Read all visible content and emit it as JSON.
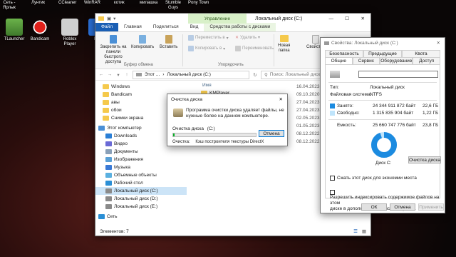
{
  "desktop": {
    "top_labels": [
      "Сеть -\nЯрлык",
      "Лунтик",
      "CCleaner",
      "WinRAR",
      "котик",
      "милашка",
      "Stumble\nGuys",
      "Pony Town"
    ],
    "icons": [
      {
        "label": "TLauncher",
        "name": "tlauncher"
      },
      {
        "label": "Bandicam",
        "name": "bandicam"
      },
      {
        "label": "Roblox\nPlayer",
        "name": "roblox-player"
      },
      {
        "label": "Ro\nSt",
        "name": "roblox-studio"
      }
    ]
  },
  "explorer": {
    "context_tab": "Управление",
    "title": "Локальный диск (C:)",
    "tabs": [
      "Файл",
      "Главная",
      "Поделиться",
      "Вид",
      "Средства работы с дисками"
    ],
    "ribbon": {
      "pin": "Закрепить на панели\nбыстрого доступа",
      "copy": "Копировать",
      "paste": "Вставить",
      "move_to": "Переместить в",
      "copy_to": "Копировать в",
      "delete": "Удалить",
      "rename": "Переименовать",
      "new_folder": "Новая\nпапка",
      "properties": "Свойства",
      "group_clipboard": "Буфер обмена",
      "group_organize": "Упорядочить"
    },
    "address": {
      "path_prefix": "Этот ...",
      "path_current": "Локальный диск (C:)",
      "search_placeholder": "Поиск: Локальный диск (C:)"
    },
    "nav_items": [
      {
        "label": "Windows",
        "icon": "folder"
      },
      {
        "label": "Bandicam",
        "icon": "folder"
      },
      {
        "label": "авы",
        "icon": "folder"
      },
      {
        "label": "обои",
        "icon": "folder"
      },
      {
        "label": "Снимки экрана",
        "icon": "folder"
      },
      {
        "label": "Этот компьютер",
        "icon": "pc"
      },
      {
        "label": "Downloads",
        "icon": "download"
      },
      {
        "label": "Видео",
        "icon": "video"
      },
      {
        "label": "Документы",
        "icon": "docs"
      },
      {
        "label": "Изображения",
        "icon": "images"
      },
      {
        "label": "Музыка",
        "icon": "music"
      },
      {
        "label": "Объемные объекты",
        "icon": "3d"
      },
      {
        "label": "Рабочий стол",
        "icon": "desktop"
      },
      {
        "label": "Локальный диск (C:)",
        "icon": "drive",
        "selected": true
      },
      {
        "label": "Локальный диск (D:)",
        "icon": "drive"
      },
      {
        "label": "Локальный диск (E:)",
        "icon": "drive"
      },
      {
        "label": "Сеть",
        "icon": "network"
      }
    ],
    "column_name": "Имя",
    "first_file": "KMPlayer",
    "dates": [
      "16.04.2023 13:",
      "09.10.2020 22:",
      "27.04.2023 13:",
      "27.04.2023 13:",
      "02.05.2023 15:",
      "01.05.2023 22:",
      "08.12.2022 22:",
      "08.12.2022 22:"
    ],
    "status": "Элементов: 7"
  },
  "cleanup": {
    "title": "Очистка диска",
    "message": "Программа очистки диска удаляет файлы, не\nнужные более на данном компьютере.",
    "drive_label": "Очистка диска",
    "drive_value": "(C:)",
    "cancel": "Отмена",
    "status_label": "Очистка:",
    "status_value": "Кэш построителя текстуры DirectX",
    "progress": 0.02
  },
  "props": {
    "title": "Свойства: Локальный диск (C:)",
    "tabs_row1": [
      "Безопасность",
      "Предыдущие версии",
      "Квота"
    ],
    "tabs_row2": [
      "Общие",
      "Сервис",
      "Оборудование",
      "Доступ"
    ],
    "type_label": "Тип:",
    "type_value": "Локальный диск",
    "fs_label": "Файловая система:",
    "fs_value": "NTFS",
    "used_label": "Занято:",
    "used_bytes": "24 344 911 872 байт",
    "used_gb": "22,6 ГБ",
    "free_label": "Свободно:",
    "free_bytes": "1 315 835 904 байт",
    "free_gb": "1,22 ГБ",
    "cap_label": "Емкость:",
    "cap_bytes": "25 660 747 776 байт",
    "cap_gb": "23,8 ГБ",
    "drive_name": "Диск C:",
    "cleanup_btn": "Очистка диска",
    "compress": "Сжать этот диск для экономии места",
    "index": "Разрешить индексировать содержимое файлов на этом\nдиске в дополнение к свойствам файла",
    "ok": "ОК",
    "cancel": "Отмена",
    "apply": "Применить",
    "used_color": "#1c8be0",
    "free_color": "#bfe4fb",
    "used_fraction": 0.949
  }
}
